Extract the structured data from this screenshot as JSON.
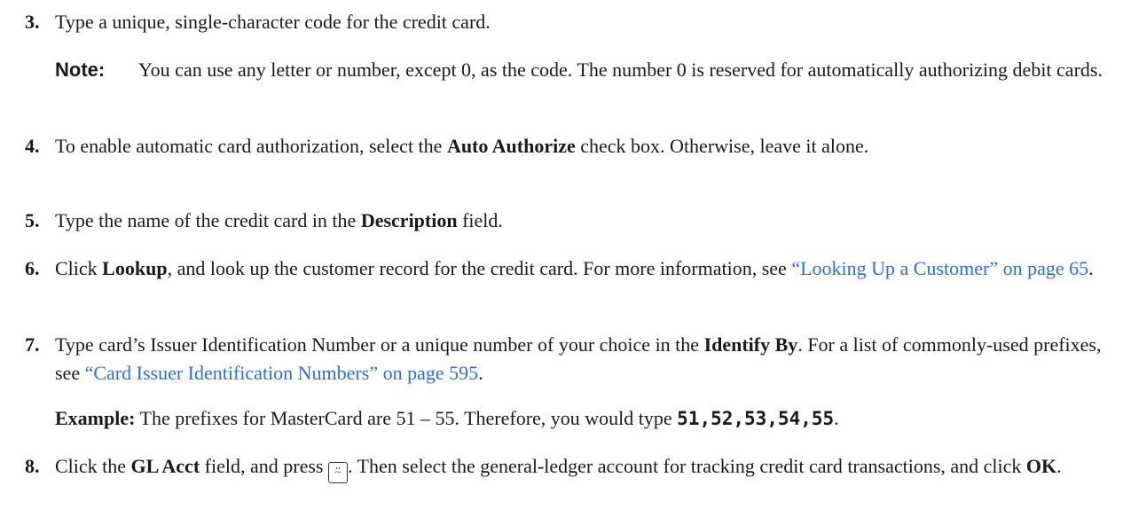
{
  "steps": [
    {
      "num": "3.",
      "text": "Type a unique, single-character code for the credit card."
    },
    {
      "num": "4.",
      "pre": "To enable automatic card authorization, select the ",
      "bold": "Auto Authorize",
      "post": " check box. Otherwise, leave it alone."
    },
    {
      "num": "5.",
      "pre": "Type the name of the credit card in the ",
      "bold": "Description",
      "post": " field."
    },
    {
      "num": "6.",
      "pre": "Click ",
      "bold": "Lookup",
      "mid": ", and look up the customer record for the credit card. For more information, see ",
      "link": "“Looking Up a Customer” on page 65",
      "post": "."
    },
    {
      "num": "7.",
      "pre": "Type card’s Issuer Identification Number or a unique number of your choice in the ",
      "bold": "Identify By",
      "mid": ". For a list of commonly-used prefixes, see ",
      "link": "“Card Issuer Identification Numbers” on page 595",
      "post": "."
    },
    {
      "num": "8.",
      "pre": "Click the ",
      "bold": "GL Acct",
      "mid": " field, and press ",
      "key_glyph": "⍨",
      "mid2": ". Then select the general-ledger account for tracking credit card transactions, and click ",
      "bold2": "OK",
      "post": "."
    }
  ],
  "note": {
    "label": "Note:",
    "text": "You can use any letter or number, except 0, as the code. The number 0 is reserved for automatically authorizing debit cards."
  },
  "example": {
    "label": "Example:",
    "text": " The prefixes for MasterCard are 51 – 55. Therefore, you would type ",
    "code": "51,52,53,54,55",
    "post": "."
  }
}
